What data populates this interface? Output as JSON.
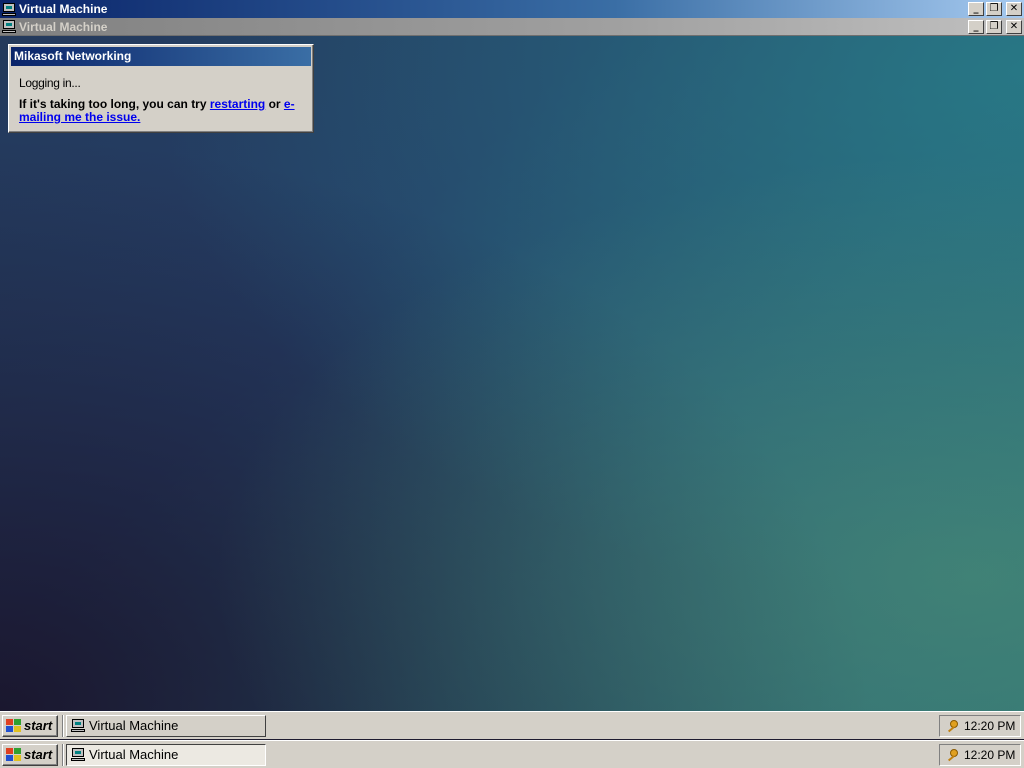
{
  "window": {
    "title_active": "Virtual Machine",
    "title_inactive": "Virtual Machine",
    "minimize_glyph": "_",
    "restore_glyph": "❐",
    "close_glyph": "✕"
  },
  "dialog": {
    "title": "Mikasoft Networking",
    "status": "Logging in...",
    "message_prefix": "If it's taking too long, you can try ",
    "link_restart": "restarting",
    "message_middle": " or ",
    "link_email": "e-mailing me the issue."
  },
  "taskbar": {
    "start_label": "start",
    "task_label": "Virtual Machine",
    "clock": "12:20 PM"
  },
  "colors": {
    "title_active": "#0a246a",
    "title_inactive": "#808080",
    "chrome": "#d4d0c8",
    "link": "#0000ee"
  },
  "icons": [
    "computer-icon",
    "minimize-icon",
    "restore-icon",
    "close-icon",
    "start-logo-icon",
    "key-tray-icon"
  ]
}
